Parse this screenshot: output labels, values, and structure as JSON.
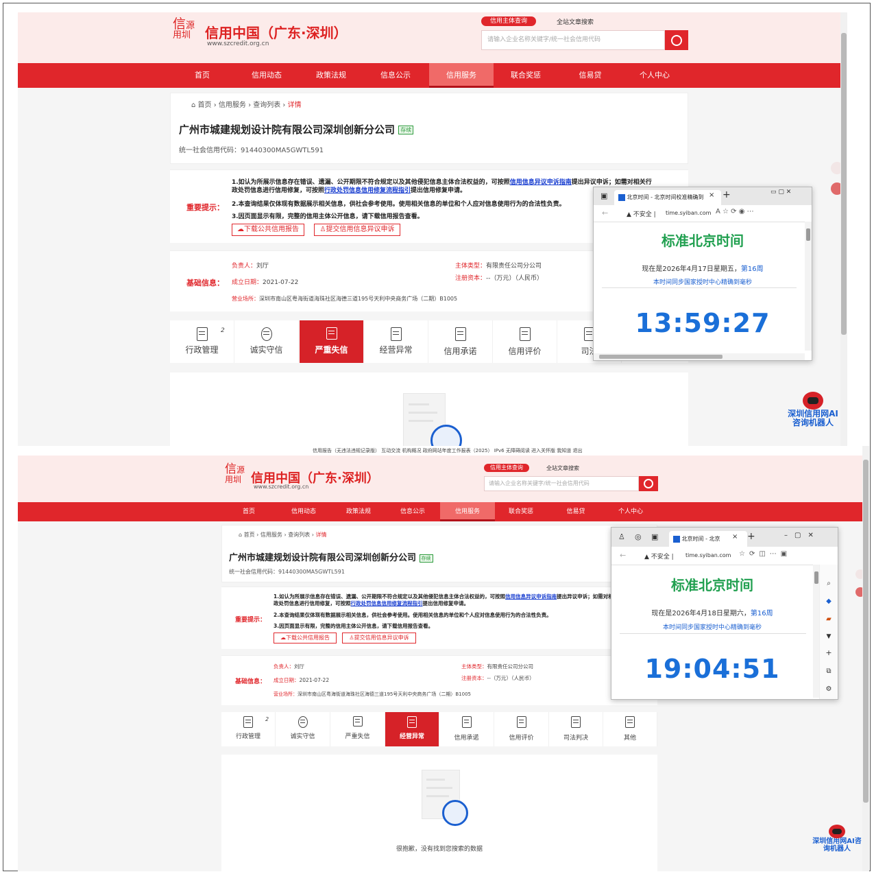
{
  "site": {
    "logo_chars": [
      "信",
      "源",
      "用",
      "圳"
    ],
    "title": "信用中国（广东·深圳）",
    "url": "www.szcredit.org.cn",
    "search_tabs": [
      "信用主体查询",
      "全站文章搜索"
    ],
    "search_placeholder": "请输入企业名称关键字/统一社会信用代码",
    "nav": [
      "首页",
      "信用动态",
      "政策法规",
      "信息公示",
      "信用服务",
      "联合奖惩",
      "信易贷",
      "个人中心"
    ],
    "nav_active": "信用服务"
  },
  "breadcrumb": [
    "首页",
    "信用服务",
    "查询列表",
    "详情"
  ],
  "company": {
    "name": "广州市城建规划设计院有限公司深圳创新分公司",
    "status": "存续",
    "credit_code": "统一社会信用代码：91440300MA5GWTL591"
  },
  "notice": {
    "label": "重要提示：",
    "line1a": "1.如认为所展示信息存在错误、遗漏、公开期限不符合规定以及其他侵犯信息主体合法权益的，可按照",
    "line1_link": "信用信息异议申诉指南",
    "line1b": "提出异议申诉；如需对相关行",
    "line1c": "政处罚信息进行信用修复，可按照",
    "line1_link2": "行政处罚信息信用修复流程指引",
    "line1d": "提出信用修复申请。",
    "line2": "2.本查询结果仅体现有数据展示相关信息，供社会参考使用。使用相关信息的单位和个人应对信息使用行为的合法性负责。",
    "line3": "3.因页面显示有限，完整的信用主体公开信息，请下载信用报告查看。",
    "btn_download": "下载公共信用报告",
    "btn_objection": "提交信用信息异议申诉"
  },
  "basic": {
    "label": "基础信息：",
    "leader_k": "负责人：",
    "leader_v": "刘厅",
    "date_k": "成立日期：",
    "date_v": "2021-07-22",
    "addr_k": "营业场所：",
    "addr_v": "深圳市南山区粤海街道海珠社区海德三道195号天利中央商务广场（二期）B1005",
    "type_k": "主体类型：",
    "type_v": "有限责任公司分公司",
    "cap_k": "注册资本：",
    "cap_v": "--（万元）（人民币）"
  },
  "categories_top": [
    "行政管理",
    "诚实守信",
    "严重失信",
    "经营异常",
    "信用承诺",
    "信用评价",
    "司法"
  ],
  "categories_bottom": [
    "行政管理",
    "诚实守信",
    "严重失信",
    "经营异常",
    "信用承诺",
    "信用评价",
    "司法判决",
    "其他"
  ],
  "cat_badge": "2",
  "cat_active_top": "严重失信",
  "cat_active_bottom": "经营异常",
  "empty_text": "很抱歉，没有找到您搜索的数据",
  "robot": "深圳信用网AI咨询机器人",
  "footer_strip": "信用报告（无违法违规记录版）  互动交流  机构概况  政府网站年度工作报表（2025）  IPv6  无障碍阅读  进入关怀版  我知道  退出",
  "browser_top": {
    "tab": "北京时间 - 北京时间校准精确到",
    "warn": "不安全",
    "url": "time.syiban.com",
    "title": "标准北京时间",
    "date": "现在是2026年4月17日星期五，",
    "week": "第16周",
    "sync": "本时间同步国家授时中心精确到毫秒",
    "time": "13:59:27"
  },
  "browser_bottom": {
    "tab": "北京时间 - 北京",
    "warn": "不安全",
    "url": "time.syiban.com",
    "title": "标准北京时间",
    "date": "现在是2026年4月18日星期六，",
    "week": "第16周",
    "sync": "本时间同步国家授时中心精确到毫秒",
    "time": "19:04:51"
  }
}
